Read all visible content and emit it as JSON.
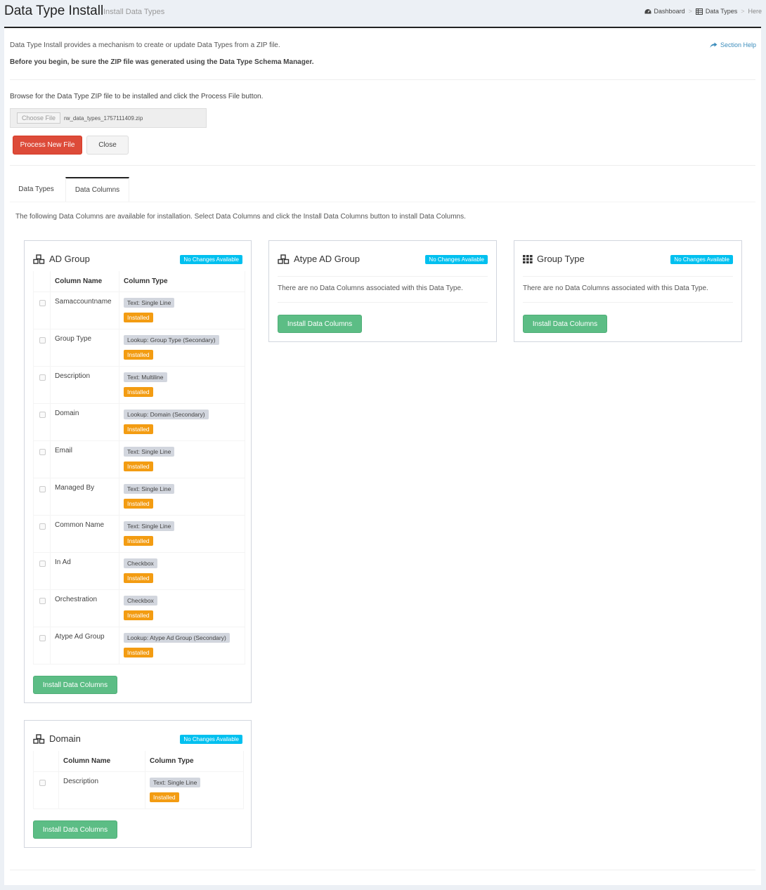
{
  "header": {
    "title": "Data Type Install",
    "subtitle": "Install Data Types"
  },
  "breadcrumb": {
    "dashboard": "Dashboard",
    "data_types": "Data Types",
    "here": "Here",
    "separator": ">"
  },
  "intro": {
    "line1": "Data Type Install provides a mechanism to create or update Data Types from a ZIP file.",
    "line2": "Before you begin, be sure the ZIP file was generated using the Data Type Schema Manager.",
    "help": "Section Help"
  },
  "upload": {
    "browse_text": "Browse for the Data Type ZIP file to be installed and click the Process File button.",
    "choose_label": "Choose File",
    "file_name": "rw_data_types_1757111409.zip",
    "process_label": "Process New File",
    "close_label": "Close"
  },
  "tabs": {
    "data_types": "Data Types",
    "data_columns": "Data Columns"
  },
  "tab_description": "The following Data Columns are available for installation. Select Data Columns and click the Install Data Columns button to install Data Columns.",
  "common": {
    "badge": "No Changes Available",
    "col_name": "Column Name",
    "col_type": "Column Type",
    "installed": "Installed",
    "install_button": "Install Data Columns",
    "empty": "There are no Data Columns associated with this Data Type."
  },
  "cards": {
    "ad_group": {
      "title": "AD Group",
      "rows": [
        {
          "name": "Samaccountname",
          "type": "Text: Single Line"
        },
        {
          "name": "Group Type",
          "type": "Lookup: Group Type (Secondary)"
        },
        {
          "name": "Description",
          "type": "Text: Multiline"
        },
        {
          "name": "Domain",
          "type": "Lookup: Domain (Secondary)"
        },
        {
          "name": "Email",
          "type": "Text: Single Line"
        },
        {
          "name": "Managed By",
          "type": "Text: Single Line"
        },
        {
          "name": "Common Name",
          "type": "Text: Single Line"
        },
        {
          "name": "In Ad",
          "type": "Checkbox"
        },
        {
          "name": "Orchestration",
          "type": "Checkbox"
        },
        {
          "name": "Atype Ad Group",
          "type": "Lookup: Atype Ad Group (Secondary)"
        }
      ]
    },
    "atype_ad_group": {
      "title": "Atype AD Group"
    },
    "group_type": {
      "title": "Group Type"
    },
    "domain": {
      "title": "Domain",
      "rows": [
        {
          "name": "Description",
          "type": "Text: Single Line"
        }
      ]
    }
  },
  "colors": {
    "danger": "#dd4b39",
    "success": "#5cbd85",
    "info": "#00c0ef",
    "warning": "#f39c12",
    "link": "#3c8dbc"
  }
}
